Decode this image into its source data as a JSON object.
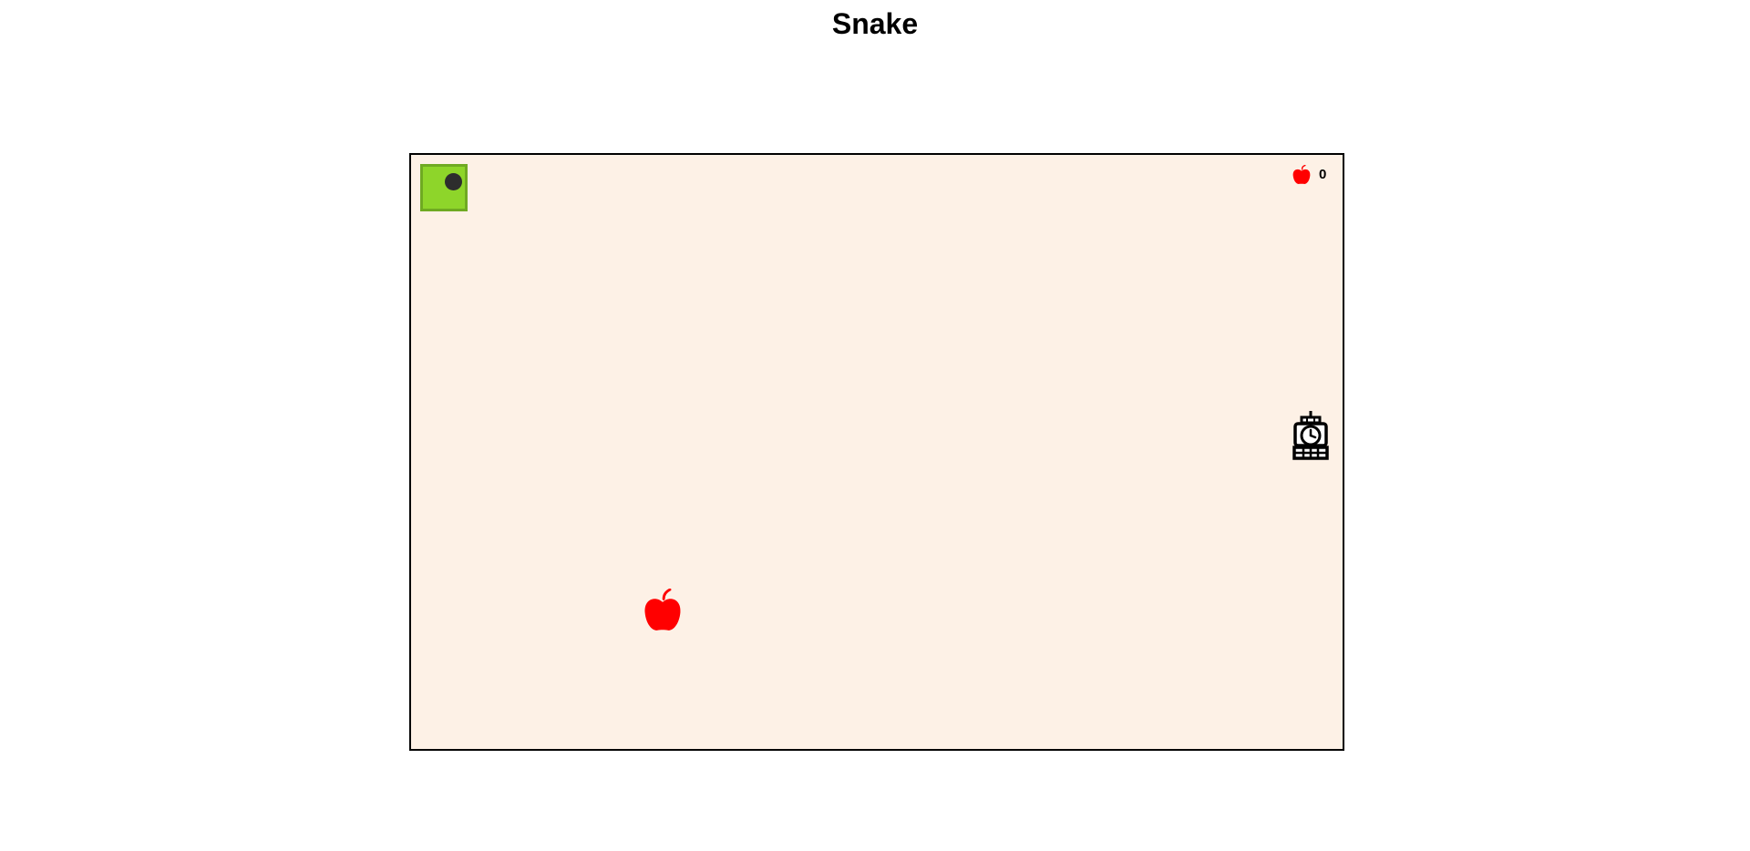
{
  "page": {
    "title": "Snake"
  },
  "game": {
    "score": "0",
    "score_icon": "apple-icon",
    "food_icon": "apple-icon",
    "enemy_icon": "clock-robot-icon",
    "colors": {
      "board_background": "#fdf1e6",
      "snake_fill": "#8ed52a",
      "snake_border": "#6faa22",
      "snake_eye": "#2d2d2d",
      "apple": "#ff0000"
    }
  }
}
